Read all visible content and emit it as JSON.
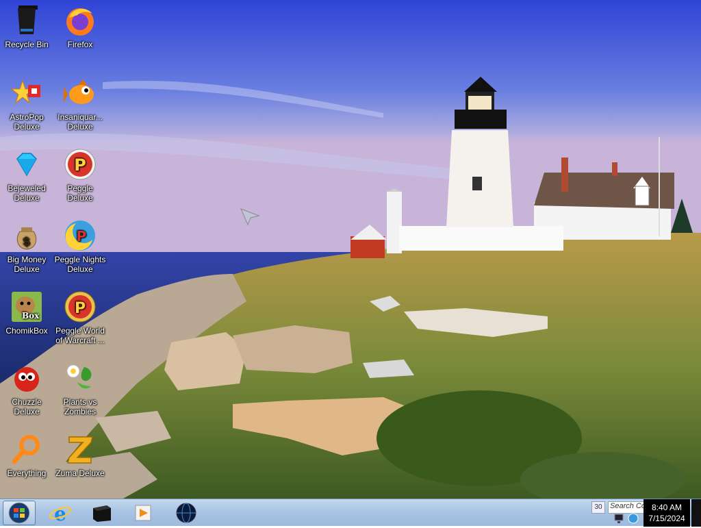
{
  "desktop": {
    "icons": [
      {
        "label": "Recycle Bin",
        "icon": "recycle-bin-icon"
      },
      {
        "label": "Firefox",
        "icon": "firefox-icon"
      },
      {
        "label": "AstroPop\nDeluxe",
        "icon": "astropop-icon"
      },
      {
        "label": "Insaniquar...\nDeluxe",
        "icon": "insaniquarium-icon"
      },
      {
        "label": "Bejeweled\nDeluxe",
        "icon": "bejeweled-icon"
      },
      {
        "label": "Peggle Deluxe",
        "icon": "peggle-icon"
      },
      {
        "label": "Big Money\nDeluxe",
        "icon": "big-money-icon"
      },
      {
        "label": "Peggle Nights\nDeluxe",
        "icon": "peggle-nights-icon"
      },
      {
        "label": "ChomikBox",
        "icon": "chomikbox-icon",
        "badge": "Box"
      },
      {
        "label": "Peggle World\nof Warcraft ...",
        "icon": "peggle-wow-icon"
      },
      {
        "label": "Chuzzle\nDeluxe",
        "icon": "chuzzle-icon"
      },
      {
        "label": "Plants vs\nZombies",
        "icon": "plants-vs-zombies-icon"
      },
      {
        "label": "Everything",
        "icon": "everything-search-icon"
      },
      {
        "label": "Zuma Deluxe",
        "icon": "zuma-icon"
      }
    ]
  },
  "taskbar": {
    "pinned": [
      "internet-explorer-icon",
      "app-black-box-icon",
      "media-player-icon",
      "globe-icon"
    ],
    "tray": {
      "number": "30",
      "search_placeholder": "Search Co",
      "time": "8:40 AM",
      "date": "7/15/2024"
    }
  },
  "colors": {
    "taskbar": "#a9c4e3",
    "sky_top": "#3a4fd0",
    "clock_bg": "#000000"
  }
}
